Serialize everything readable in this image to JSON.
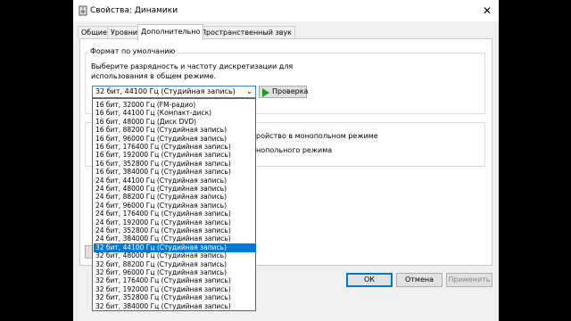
{
  "window": {
    "title": "Свойства: Динамики",
    "close_glyph": "✕"
  },
  "tabs": [
    "Общие",
    "Уровни",
    "Дополнительно",
    "Пространственный звук"
  ],
  "active_tab": 2,
  "default_format": {
    "group_title": "Формат по умолчанию",
    "description_line1": "Выберите разрядность и частоту дискретизации для",
    "description_line2": "использования в общем режиме.",
    "selected_value": "32 бит, 44100 Гц (Студийная запись)",
    "test_button": "Проверка"
  },
  "exclusive_mode": {
    "line1_visible": "ройство в монопольном режиме",
    "line2_visible": "нопольного режима"
  },
  "dropdown": {
    "selected_index": 17,
    "options": [
      "16 бит, 32000 Гц (FM-радио)",
      "16 бит, 44100 Гц (Компакт-диск)",
      "16 бит, 48000 Гц (Диск DVD)",
      "16 бит, 88200 Гц (Студийная запись)",
      "16 бит, 96000 Гц (Студийная запись)",
      "16 бит, 176400 Гц (Студийная запись)",
      "16 бит, 192000 Гц (Студийная запись)",
      "16 бит, 352800 Гц (Студийная запись)",
      "16 бит, 384000 Гц (Студийная запись)",
      "24 бит, 44100 Гц (Студийная запись)",
      "24 бит, 48000 Гц (Студийная запись)",
      "24 бит, 88200 Гц (Студийная запись)",
      "24 бит, 96000 Гц (Студийная запись)",
      "24 бит, 176400 Гц (Студийная запись)",
      "24 бит, 192000 Гц (Студийная запись)",
      "24 бит, 352800 Гц (Студийная запись)",
      "24 бит, 384000 Гц (Студийная запись)",
      "32 бит, 44100 Гц (Студийная запись)",
      "32 бит, 48000 Гц (Студийная запись)",
      "32 бит, 88200 Гц (Студийная запись)",
      "32 бит, 96000 Гц (Студийная запись)",
      "32 бит, 176400 Гц (Студийная запись)",
      "32 бит, 192000 Гц (Студийная запись)",
      "32 бит, 352800 Гц (Студийная запись)",
      "32 бит, 384000 Гц (Студийная запись)"
    ]
  },
  "buttons": {
    "ok": "ОК",
    "cancel": "Отмена",
    "apply": "Применить"
  },
  "colors": {
    "selection": "#0078d7",
    "test_icon": "#1e9b24"
  }
}
